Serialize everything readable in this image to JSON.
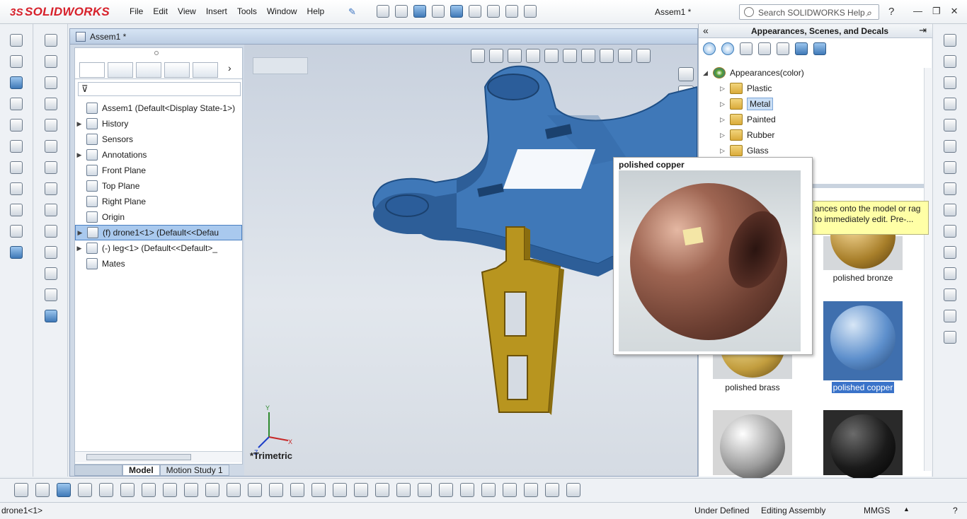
{
  "app": {
    "logo_text": "SOLIDWORKS",
    "logo_prefix": "3S",
    "doc_title": "Assem1 *"
  },
  "menu": [
    "File",
    "Edit",
    "View",
    "Insert",
    "Tools",
    "Window",
    "Help"
  ],
  "search": {
    "placeholder": "Search SOLIDWORKS Help"
  },
  "doc_window": {
    "tab_title": "Assem1 *",
    "view_label": "*Trimetric"
  },
  "feature_manager": {
    "tree": [
      {
        "label": "Assem1  (Default<Display State-1>)",
        "expandable": false
      },
      {
        "label": "History",
        "expandable": true
      },
      {
        "label": "Sensors",
        "expandable": false
      },
      {
        "label": "Annotations",
        "expandable": true
      },
      {
        "label": "Front Plane",
        "expandable": false
      },
      {
        "label": "Top Plane",
        "expandable": false
      },
      {
        "label": "Right Plane",
        "expandable": false
      },
      {
        "label": "Origin",
        "expandable": false
      },
      {
        "label": "(f) drone1<1> (Default<<Defau",
        "expandable": true,
        "selected": true
      },
      {
        "label": "(-) leg<1> (Default<<Default>_",
        "expandable": true
      },
      {
        "label": "Mates",
        "expandable": false
      }
    ],
    "bottom_tabs": [
      "Model",
      "Motion Study 1"
    ]
  },
  "task_pane": {
    "title": "Appearances, Scenes, and Decals",
    "tree": [
      {
        "label": "Appearances(color)",
        "root": true
      },
      {
        "label": "Plastic"
      },
      {
        "label": "Metal",
        "selected": true
      },
      {
        "label": "Painted"
      },
      {
        "label": "Rubber"
      },
      {
        "label": "Glass"
      }
    ],
    "hint": "ances onto the model or rag to immediately edit.  Pre-...",
    "swatches": [
      {
        "label": "polished bronze"
      },
      {
        "label": "polished brass"
      },
      {
        "label": "polished copper",
        "selected": true
      },
      {
        "label": ""
      },
      {
        "label": ""
      }
    ]
  },
  "preview": {
    "title": "polished copper"
  },
  "status": {
    "selection": "drone1<1>",
    "state": "Under Defined",
    "mode": "Editing Assembly",
    "units": "MMGS"
  },
  "colors": {
    "model_blue": "#3f78b8",
    "leg_gold": "#b8951f",
    "copper": "#8a5243",
    "selection_blue": "#a9c9ee",
    "tooltip_yellow": "#ffffa6"
  }
}
